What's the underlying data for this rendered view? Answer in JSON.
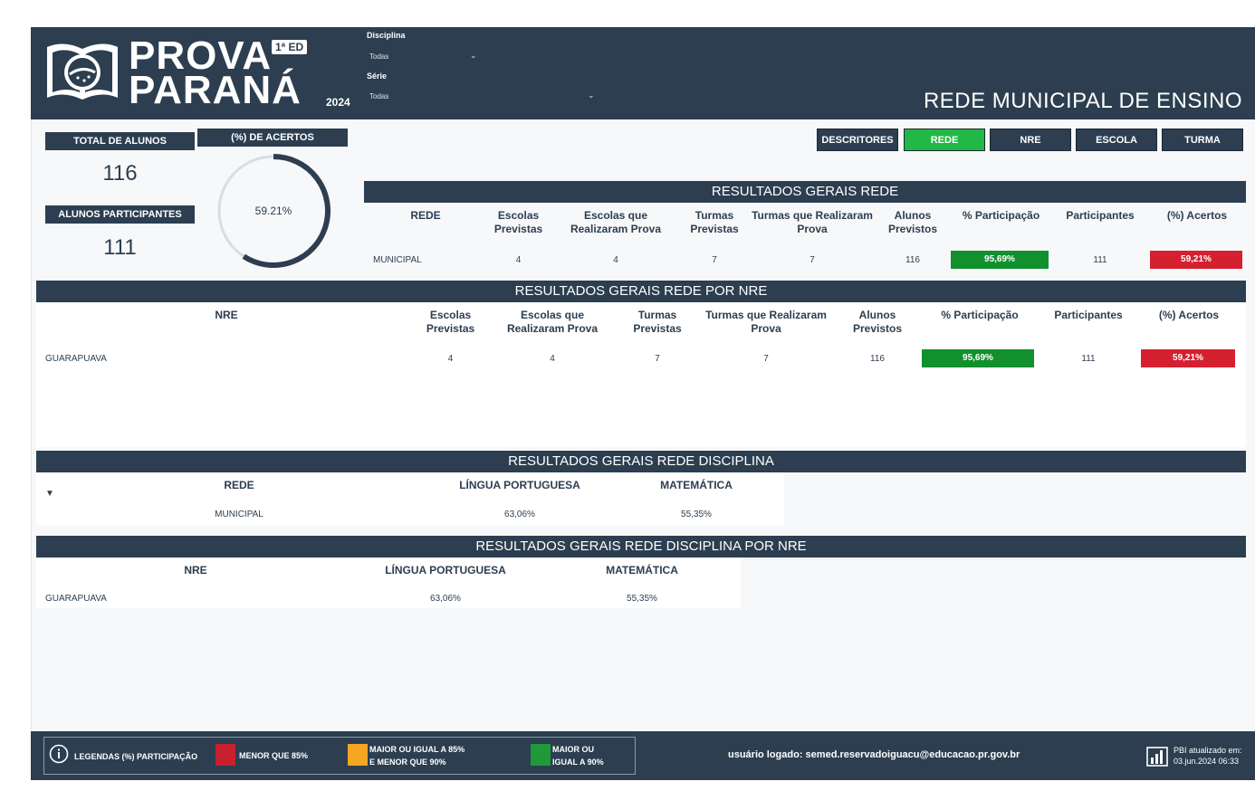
{
  "header": {
    "logo": {
      "word1": "PROVA",
      "word2": "PARANÁ",
      "edition": "1ª ED",
      "year": "2024"
    },
    "filters": [
      {
        "label": "Disciplina",
        "value": "Todas"
      },
      {
        "label": "Série",
        "value": "Todas"
      }
    ],
    "title": "REDE MUNICIPAL DE ENSINO"
  },
  "kpis": {
    "total_label": "TOTAL DE ALUNOS",
    "total_value": "116",
    "participants_label": "ALUNOS PARTICIPANTES",
    "participants_value": "111",
    "accuracy_label": "(%) DE ACERTOS",
    "accuracy_value": "59.21%",
    "accuracy_fraction": 0.5921
  },
  "nav": [
    "DESCRITORES",
    "REDE",
    "NRE",
    "ESCOLA",
    "TURMA"
  ],
  "nav_active": "REDE",
  "tables": {
    "rede": {
      "title": "RESULTADOS GERAIS REDE",
      "headers": [
        "REDE",
        "Escolas Previstas",
        "Escolas que Realizaram Prova",
        "Turmas Previstas",
        "Turmas que Realizaram Prova",
        "Alunos Previstos",
        "% Participação",
        "Participantes",
        "(%) Acertos"
      ],
      "row": [
        "MUNICIPAL",
        "4",
        "4",
        "7",
        "7",
        "116",
        "95,69%",
        "111",
        "59,21%"
      ]
    },
    "rede_nre": {
      "title": "RESULTADOS GERAIS REDE POR NRE",
      "headers": [
        "NRE",
        "Escolas Previstas",
        "Escolas que Realizaram Prova",
        "Turmas Previstas",
        "Turmas que Realizaram Prova",
        "Alunos Previstos",
        "% Participação",
        "Participantes",
        "(%) Acertos"
      ],
      "row": [
        "GUARAPUAVA",
        "4",
        "4",
        "7",
        "7",
        "116",
        "95,69%",
        "111",
        "59,21%"
      ]
    },
    "disciplina": {
      "title": "RESULTADOS GERAIS REDE DISCIPLINA",
      "headers": [
        "REDE",
        "LÍNGUA PORTUGUESA",
        "MATEMÁTICA"
      ],
      "row": [
        "MUNICIPAL",
        "63,06%",
        "55,35%"
      ]
    },
    "disciplina_nre": {
      "title": "RESULTADOS GERAIS REDE DISCIPLINA POR NRE",
      "headers": [
        "NRE",
        "LÍNGUA PORTUGUESA",
        "MATEMÁTICA"
      ],
      "row": [
        "GUARAPUAVA",
        "63,06%",
        "55,35%"
      ]
    }
  },
  "footer": {
    "legend_title": "LEGENDAS (%) PARTICIPAÇÃO",
    "legend_items": [
      {
        "label": "MENOR QUE 85%",
        "color": "#c8202e"
      },
      {
        "label_line1": "MAIOR OU IGUAL A 85%",
        "label_line2": "E MENOR QUE 90%",
        "color": "#f5a623"
      },
      {
        "label_line1": "MAIOR OU",
        "label_line2": "IGUAL A 90%",
        "color": "#1f9a3a"
      }
    ],
    "user": "usuário logado: semed.reservadoiguacu@educacao.pr.gov.br",
    "pbi_line1": "PBI atualizado em:",
    "pbi_line2": "03.jun.2024 06:33"
  },
  "colors": {
    "navy": "#2c3e50",
    "green": "#11902d",
    "red": "#d5202f",
    "active_green": "#22b845"
  }
}
